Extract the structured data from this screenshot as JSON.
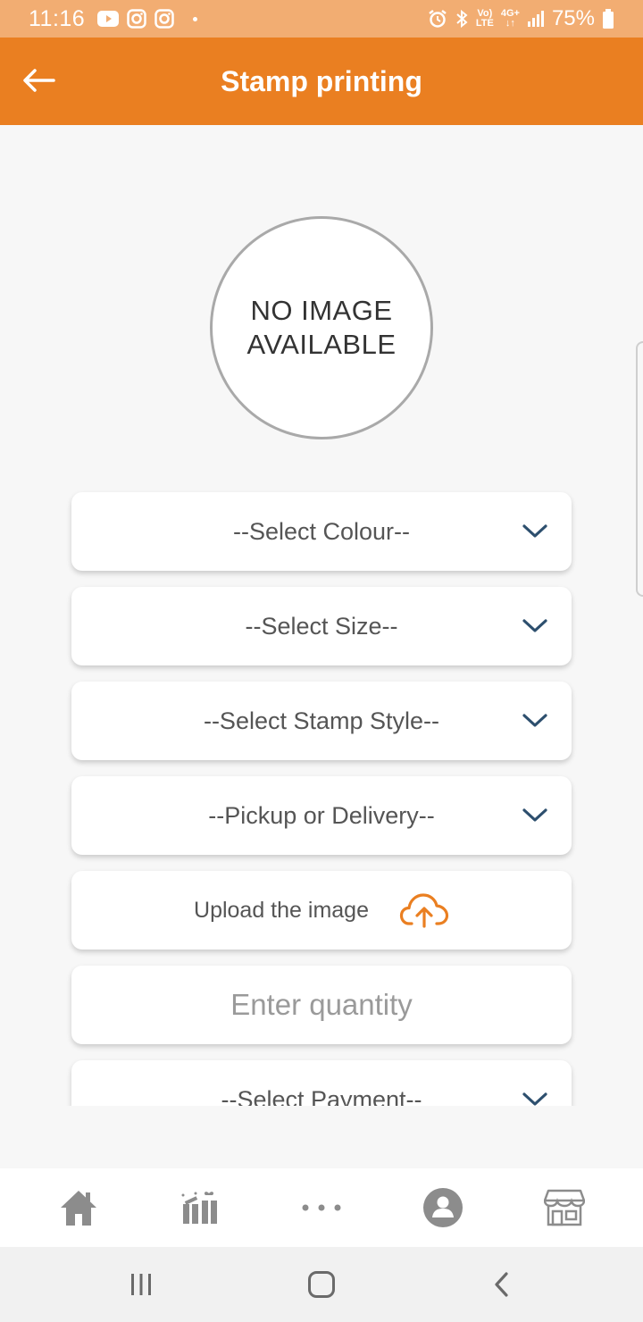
{
  "status_bar": {
    "time": "11:16",
    "network_top": "Vo)",
    "network_bottom": "LTE",
    "data_top": "4G+",
    "battery": "75%"
  },
  "app_bar": {
    "title": "Stamp printing"
  },
  "image_placeholder": {
    "text": "NO IMAGE AVAILABLE"
  },
  "form": {
    "colour_label": "--Select Colour--",
    "size_label": "--Select Size--",
    "style_label": "--Select Stamp Style--",
    "pickup_label": "--Pickup or Delivery--",
    "upload_label": "Upload the image",
    "quantity_placeholder": "Enter quantity",
    "payment_label": "--Select Payment--"
  },
  "colors": {
    "brand": "#ea7f21",
    "status_bar": "#f2ad72",
    "chevron": "#2d4f6e",
    "nav_icon": "#8c8c8c"
  },
  "icons": {
    "back": "arrow-left-icon",
    "dropdown": "chevron-down-icon",
    "upload": "cloud-upload-icon",
    "nav": [
      "home-icon",
      "gift-icon",
      "more-icon",
      "profile-icon",
      "store-icon"
    ]
  }
}
